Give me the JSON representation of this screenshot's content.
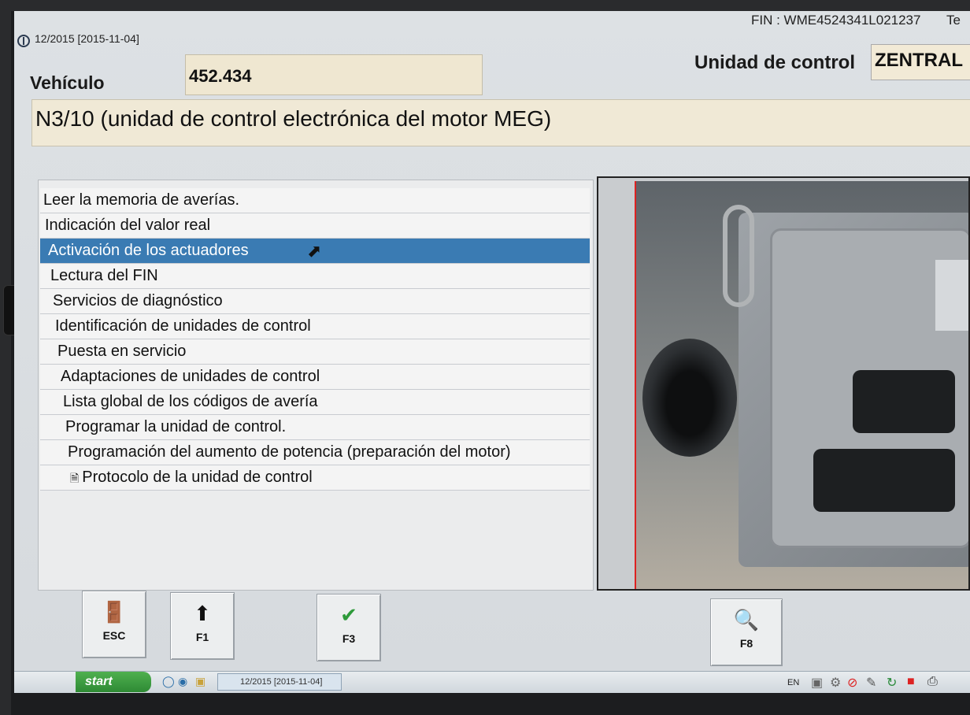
{
  "window": {
    "date_label": "12/2015 [2015-11-04]",
    "fin_label": "FIN : WME4524341L021237",
    "te_label": "Te"
  },
  "vehicle": {
    "label": "Vehículo",
    "value": "452.434"
  },
  "control_unit": {
    "label": "Unidad de control",
    "value": "ZENTRAL"
  },
  "module": {
    "title": "N3/10 (unidad de control electrónica del motor MEG)"
  },
  "menu": {
    "items": [
      {
        "label": "Leer la memoria de averías."
      },
      {
        "label": "Indicación del valor real"
      },
      {
        "label": "Activación de los actuadores"
      },
      {
        "label": "Lectura del FIN"
      },
      {
        "label": "Servicios de diagnóstico"
      },
      {
        "label": "Identificación de unidades de control"
      },
      {
        "label": "Puesta en servicio"
      },
      {
        "label": "Adaptaciones de unidades de control"
      },
      {
        "label": "Lista global de los códigos de avería"
      },
      {
        "label": "Programar la unidad de control."
      },
      {
        "label": "Programación del aumento de potencia (preparación del motor)"
      },
      {
        "label": "Protocolo de la unidad de control",
        "icon": "document-icon"
      }
    ],
    "selected_index": 2,
    "selected_color": "#3a7bb3"
  },
  "function_keys": {
    "esc": {
      "label": "ESC",
      "icon": "exit-door-icon"
    },
    "f1": {
      "label": "F1",
      "icon": "arrow-up-icon"
    },
    "f3": {
      "label": "F3",
      "icon": "checkmark-icon"
    },
    "f8": {
      "label": "F8",
      "icon": "magnifier-icon"
    }
  },
  "taskbar": {
    "start_label": "start",
    "task_label": "12/2015 [2015-11-04]",
    "lang": "EN"
  }
}
